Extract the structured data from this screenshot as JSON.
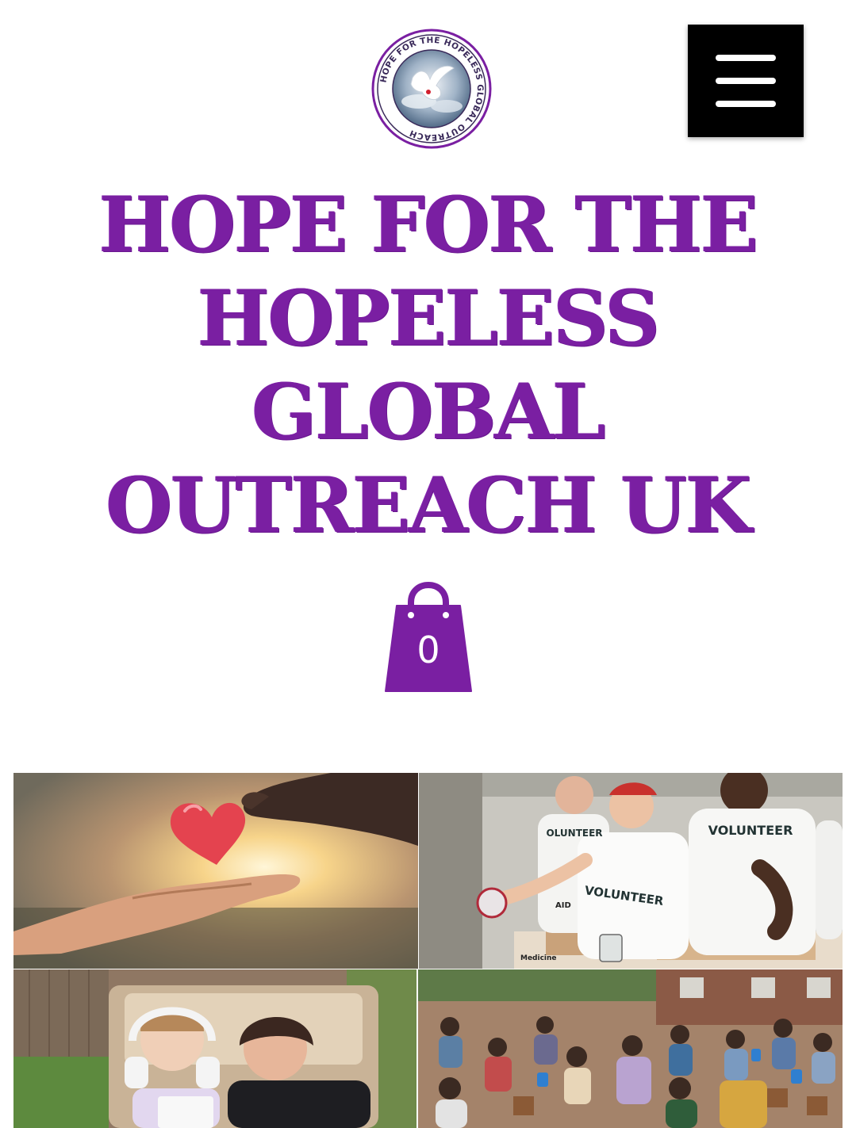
{
  "logo": {
    "ring_text": "HOPE FOR THE HOPELESS GLOBAL OUTREACH"
  },
  "header": {
    "menu_icon": "hamburger-icon"
  },
  "site": {
    "title_lines": [
      "HOPE FOR THE",
      "HOPELESS",
      "GLOBAL",
      "OUTREACH UK"
    ]
  },
  "cart": {
    "icon": "shopping-bag-icon",
    "count": "0"
  },
  "gallery": {
    "images": [
      {
        "name": "hands-heart"
      },
      {
        "name": "volunteers",
        "shirt_text": "VOLUNTEER",
        "shirt_text_partial": "OLUNTEER",
        "box_text_1": "AID",
        "box_text_2": "Medicine"
      },
      {
        "name": "caregiver-child"
      },
      {
        "name": "community-gathering"
      }
    ]
  },
  "colors": {
    "brand_purple": "#7a1fa2",
    "menu_bg": "#000000",
    "page_bg": "#ffffff"
  }
}
